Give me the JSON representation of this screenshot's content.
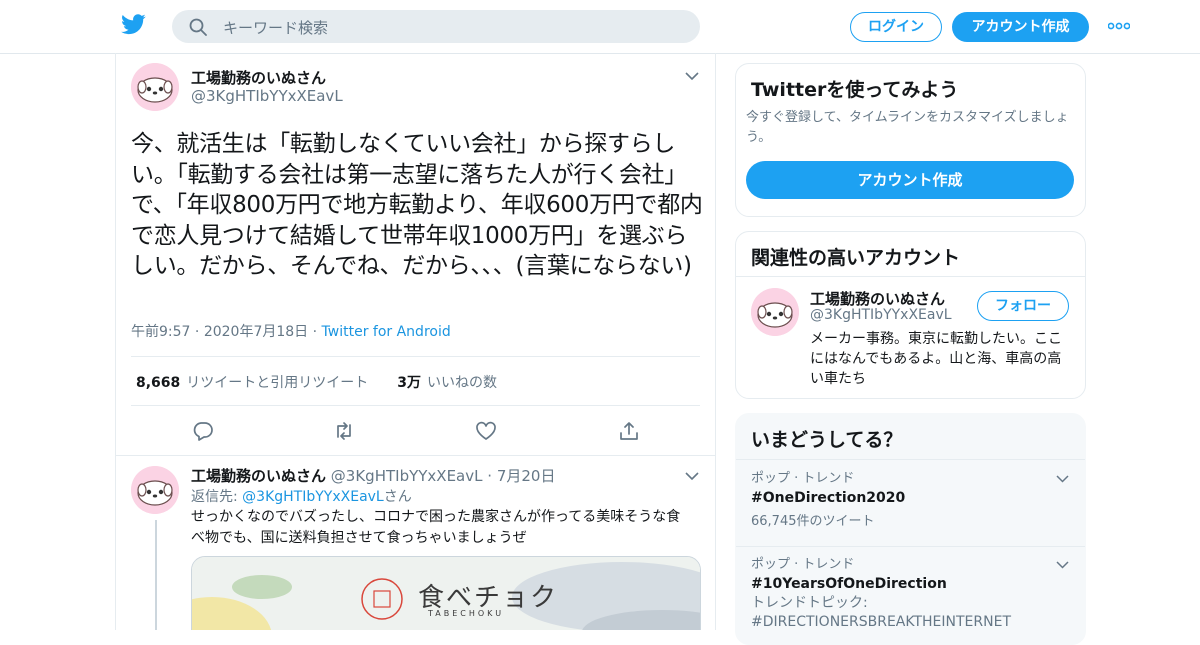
{
  "header": {
    "logo": "twitter-bird-icon",
    "search_placeholder": "キーワード検索",
    "login_label": "ログイン",
    "signup_label": "アカウント作成",
    "more_icon": "more-dots-icon",
    "accent_color": "#1da1f2"
  },
  "tweet": {
    "author_name": "工場勤務のいぬさん",
    "author_handle": "@3KgHTIbYYxXEavL",
    "text": "今、就活生は「転勤しなくていい会社」から探すらしい。「転勤する会社は第一志望に落ちた人が行く会社」で、「年収800万円で地方転勤より、年収600万円で都内で恋人見つけて結婚して世帯年収1000万円」を選ぶらしい。だから、そんでね、だから、、、(言葉にならない)",
    "time": "午前9:57",
    "date": "2020年7月18日",
    "source": "Twitter for Android",
    "retweet_count": "8,668",
    "retweet_label": "リツイートと引用リツイート",
    "like_count": "3万",
    "like_label": "いいねの数",
    "actions": [
      "reply-icon",
      "retweet-icon",
      "like-icon",
      "share-icon"
    ]
  },
  "reply": {
    "author_name": "工場勤務のいぬさん",
    "author_handle": "@3KgHTIbYYxXEavL",
    "date": "7月20日",
    "reply_prefix": "返信先:",
    "reply_handle": "@3KgHTIbYYxXEavL",
    "reply_suffix": "さん",
    "text": "せっかくなのでバズったし、コロナで困った農家さんが作ってる美味そうな食べ物でも、国に送料負担させて食っちゃいましょうぜ",
    "media_logo_text": "食べチョク",
    "media_logo_sub": "TABECHOKU"
  },
  "sidebar": {
    "signup_card": {
      "title": "Twitterを使ってみよう",
      "subtitle": "今すぐ登録して、タイムラインをカスタマイズしましょう。",
      "cta": "アカウント作成"
    },
    "related_card": {
      "title": "関連性の高いアカウント",
      "name": "工場勤務のいぬさん",
      "handle": "@3KgHTIbYYxXEavL",
      "follow_label": "フォロー",
      "bio": "メーカー事務。東京に転勤したい。ここにはなんでもあるよ。山と海、車高の高い車たち"
    },
    "trends_card": {
      "title": "いまどうしてる？",
      "trends": [
        {
          "context": "ポップ · トレンド",
          "name": "#OneDirection2020",
          "count": "66,745件のツイート"
        },
        {
          "context": "ポップ · トレンド",
          "name": "#10YearsOfOneDirection",
          "sub": "トレンドトピック: #DIRECTIONERSBREAKTHEINTERNET"
        }
      ]
    }
  }
}
